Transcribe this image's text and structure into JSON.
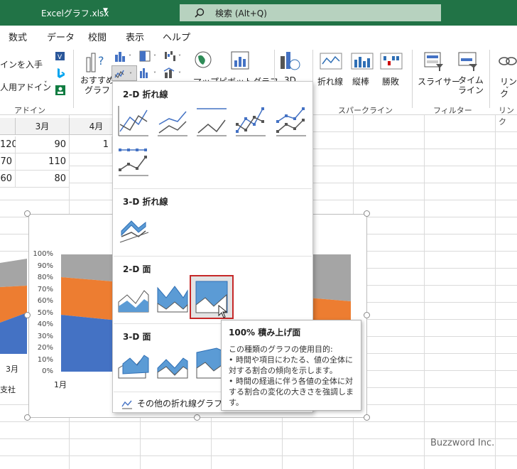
{
  "app": {
    "file_name": "Excelグラフ.xlsx",
    "search_placeholder": "検索 (Alt+Q)"
  },
  "menu": {
    "tabs": [
      "数式",
      "データ",
      "校閲",
      "表示",
      "ヘルプ"
    ]
  },
  "ribbon": {
    "addin_items": [
      "インを入手",
      "人用アドイン"
    ],
    "addin_group": "アドイン",
    "recommended_label": "おすすめ\nグラフ",
    "map_label": "マップ",
    "pivot_label": "ピボットグラフ",
    "map3d_label": "3D",
    "spark_line": "折れ線",
    "spark_column": "縦棒",
    "spark_winloss": "勝敗",
    "spark_group": "スパークライン",
    "slicer": "スライサー",
    "timeline": "タイム\nライン",
    "filter_group": "フィルター",
    "link_label": "リンク",
    "link_group": "リンク"
  },
  "sheet": {
    "col_headers": [
      "3月",
      "4月"
    ],
    "rows": [
      [
        "120",
        "90",
        "1"
      ],
      [
        "70",
        "110",
        ""
      ],
      [
        "60",
        "80",
        ""
      ]
    ]
  },
  "chart": {
    "yticks": [
      "100%",
      "90%",
      "80%",
      "70%",
      "60%",
      "50%",
      "40%",
      "30%",
      "20%",
      "10%",
      "0%"
    ],
    "left_label_month": "3月",
    "left_label_series": "支社",
    "xlabel": "1月",
    "colors": {
      "blue": "#4472c4",
      "orange": "#ed7d31",
      "gray": "#a5a5a5"
    }
  },
  "dropdown": {
    "section_2d_line": "2-D 折れ線",
    "section_3d_line": "3-D 折れ線",
    "section_2d_area": "2-D 面",
    "section_3d_area": "3-D 面",
    "more_label": "その他の折れ線グラフ(M)..."
  },
  "tooltip": {
    "title": "100% 積み上げ面",
    "body": "この種類のグラフの使用目的:\n• 時間や項目にわたる、値の全体に対する割合の傾向を示します。\n• 時間の経過に伴う各値の全体に対する割合の変化の大きさを強調します。"
  },
  "watermark": "Buzzword Inc."
}
